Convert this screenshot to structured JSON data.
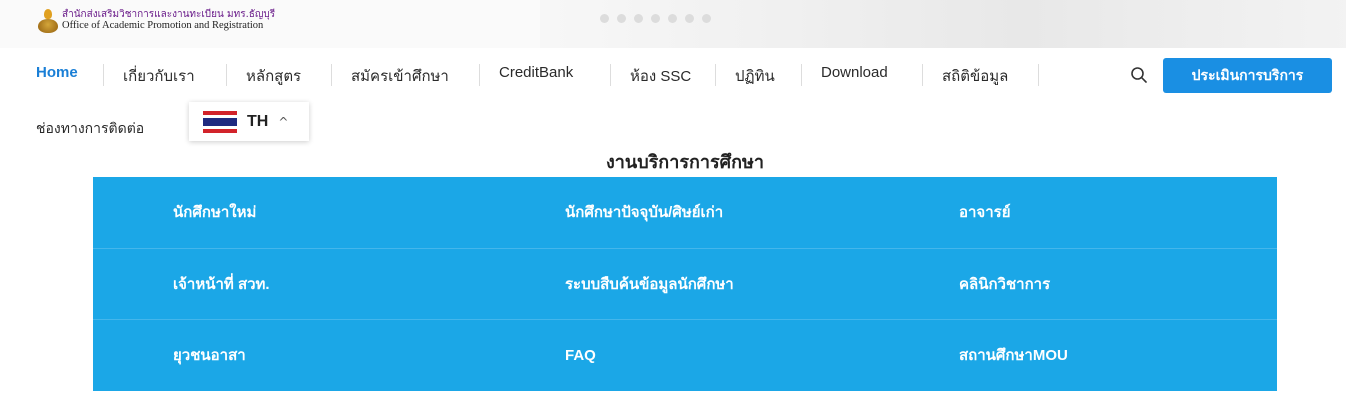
{
  "header": {
    "logo_thai": "สำนักส่งเสริมวิชาการและงานทะเบียน มทร.ธัญบุรี",
    "logo_english": "Office of Academic Promotion and Registration"
  },
  "nav": {
    "items": [
      {
        "label": "Home",
        "active": true
      },
      {
        "label": "เกี่ยวกับเรา"
      },
      {
        "label": "หลักสูตร"
      },
      {
        "label": "สมัครเข้าศึกษา"
      },
      {
        "label": "CreditBank"
      },
      {
        "label": "ห้อง SSC"
      },
      {
        "label": "ปฏิทิน"
      },
      {
        "label": "Download"
      },
      {
        "label": "สถิติข้อมูล"
      }
    ],
    "second_row": "ช่องทางการติดต่อ",
    "cta_label": "ประเมินการบริการ",
    "search_icon": "search-icon"
  },
  "language": {
    "code": "TH",
    "flag": "thai-flag-icon",
    "caret": "^"
  },
  "services": {
    "title": "งานบริการการศึกษา",
    "rows": [
      [
        "นักศึกษาใหม่",
        "นักศึกษาปัจจุบัน/ศิษย์เก่า",
        "อาจารย์"
      ],
      [
        "เจ้าหน้าที่ สวท.",
        "ระบบสืบค้นข้อมูลนักศึกษา",
        "คลินิกวิชาการ"
      ],
      [
        "ยุวชนอาสา",
        "FAQ",
        "สถานศึกษาMOU"
      ]
    ]
  },
  "colors": {
    "accent": "#1a7fd6",
    "button": "#1a8fe3",
    "grid": "#1ba7e7",
    "logo_text": "#6a1c8a"
  }
}
